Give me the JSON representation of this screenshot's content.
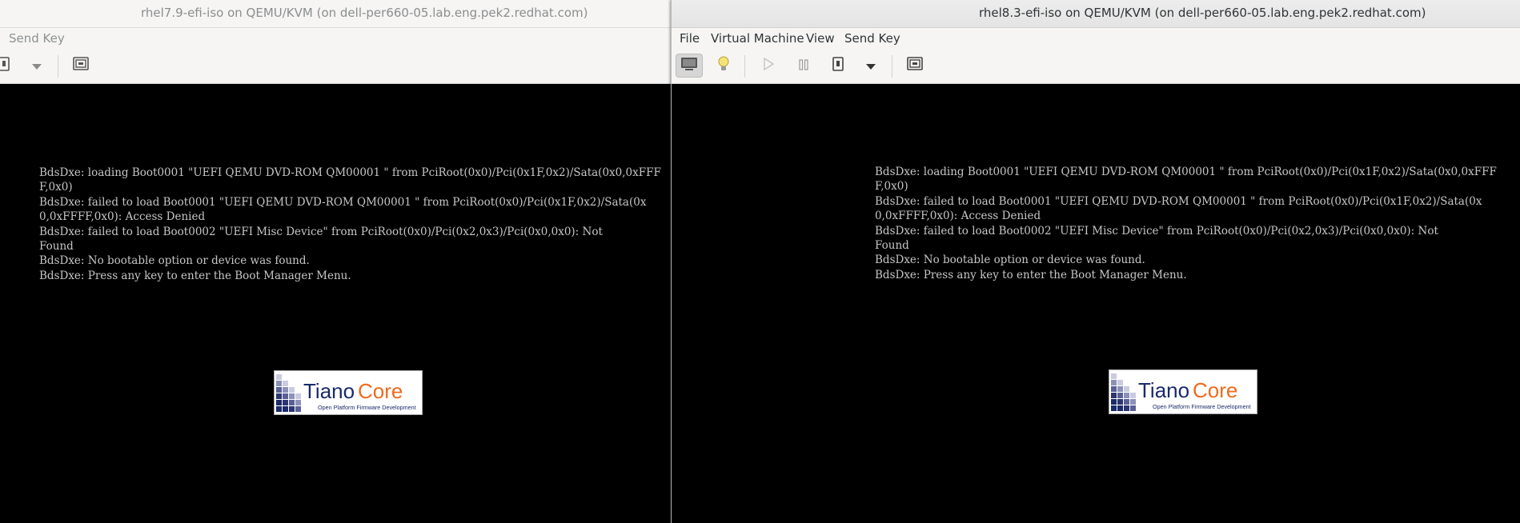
{
  "colors": {
    "titlebar_bg": "#ededed",
    "chrome_bg": "#f6f5f4",
    "console_bg": "#000000",
    "console_text": "#c6c6c6",
    "tiano_blue": "#1a2a6a",
    "tiano_orange": "#ef6b1c"
  },
  "left_window": {
    "title": "rhel7.9-efi-iso on QEMU/KVM (on dell-per660-05.lab.eng.pek2.redhat.com)",
    "menu": {
      "send_key": "Send Key"
    },
    "toolbar": {
      "icons": [
        "shutdown-icon",
        "dropdown-arrow-icon",
        "fullscreen-icon"
      ]
    },
    "console_lines": [
      "BdsDxe: loading Boot0001 \"UEFI QEMU DVD-ROM QM00001 \" from PciRoot(0x0)/Pci(0x1F,0x2)/Sata(0x0,0xFFF",
      "F,0x0)",
      "BdsDxe: failed to load Boot0001 \"UEFI QEMU DVD-ROM QM00001 \" from PciRoot(0x0)/Pci(0x1F,0x2)/Sata(0x",
      "0,0xFFFF,0x0): Access Denied",
      "BdsDxe: failed to load Boot0002 \"UEFI Misc Device\" from PciRoot(0x0)/Pci(0x2,0x3)/Pci(0x0,0x0): Not",
      "Found",
      "BdsDxe: No bootable option or device was found.",
      "BdsDxe: Press any key to enter the Boot Manager Menu."
    ],
    "logo": {
      "name_dark": "Tiano",
      "name_orange": "Core",
      "tagline": "Open Platform Firmware Development"
    }
  },
  "right_window": {
    "title": "rhel8.3-efi-iso on QEMU/KVM (on dell-per660-05.lab.eng.pek2.redhat.com)",
    "menu": {
      "file": "File",
      "virtual_machine": "Virtual Machine",
      "view": "View",
      "send_key": "Send Key"
    },
    "toolbar": {
      "icons": [
        "console-icon",
        "details-lightbulb-icon",
        "run-icon",
        "pause-icon",
        "shutdown-icon",
        "dropdown-arrow-icon",
        "fullscreen-icon"
      ]
    },
    "console_lines": [
      "BdsDxe: loading Boot0001 \"UEFI QEMU DVD-ROM QM00001 \" from PciRoot(0x0)/Pci(0x1F,0x2)/Sata(0x0,0xFFF",
      "F,0x0)",
      "BdsDxe: failed to load Boot0001 \"UEFI QEMU DVD-ROM QM00001 \" from PciRoot(0x0)/Pci(0x1F,0x2)/Sata(0x",
      "0,0xFFFF,0x0): Access Denied",
      "BdsDxe: failed to load Boot0002 \"UEFI Misc Device\" from PciRoot(0x0)/Pci(0x2,0x3)/Pci(0x0,0x0): Not",
      "Found",
      "BdsDxe: No bootable option or device was found.",
      "BdsDxe: Press any key to enter the Boot Manager Menu."
    ],
    "logo": {
      "name_dark": "Tiano",
      "name_orange": "Core",
      "tagline": "Open Platform Firmware Development"
    }
  }
}
